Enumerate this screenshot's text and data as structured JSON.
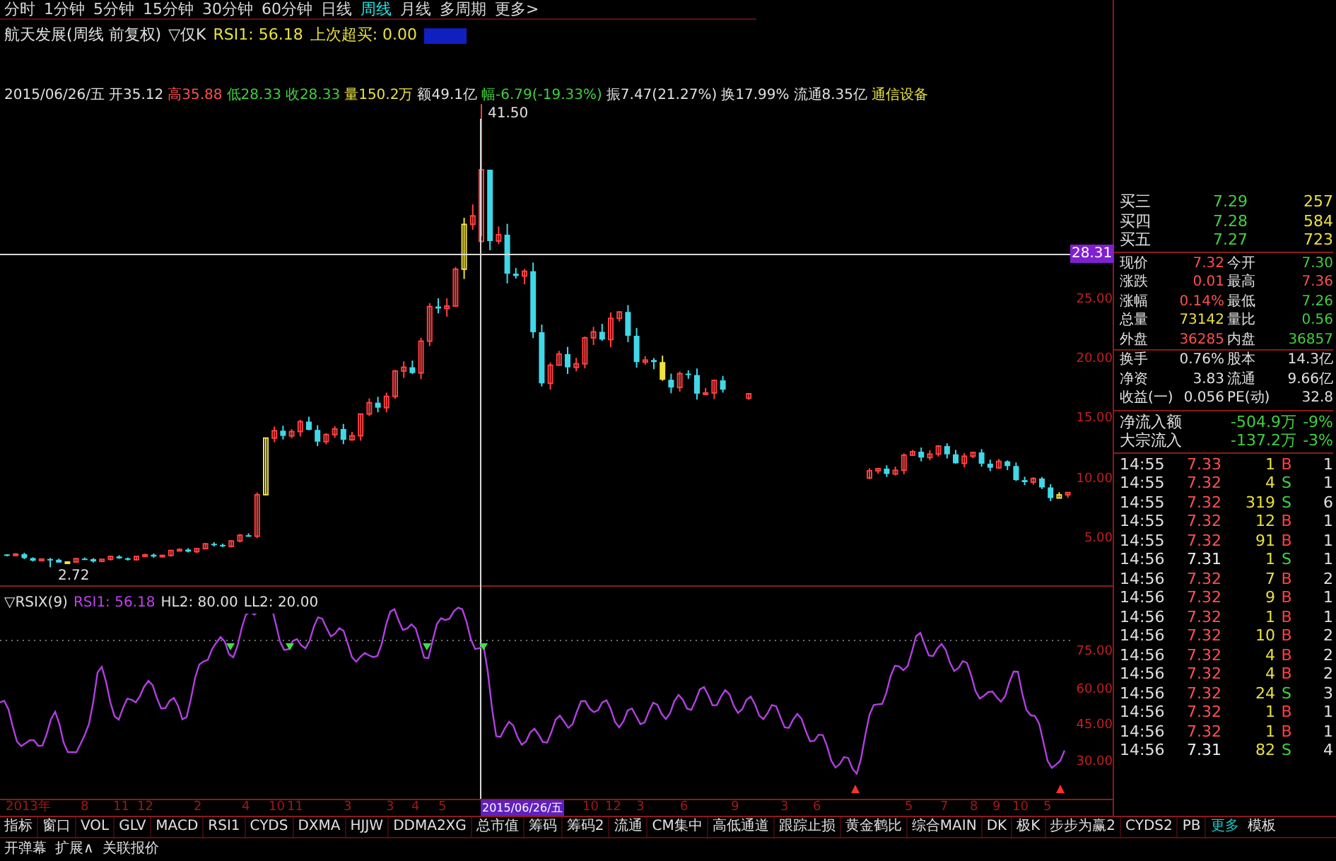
{
  "period_tabs": [
    {
      "label": "分时",
      "selected": false
    },
    {
      "label": "1分钟",
      "selected": false
    },
    {
      "label": "5分钟",
      "selected": false
    },
    {
      "label": "15分钟",
      "selected": false
    },
    {
      "label": "30分钟",
      "selected": false
    },
    {
      "label": "60分钟",
      "selected": false
    },
    {
      "label": "日线",
      "selected": false
    },
    {
      "label": "周线",
      "selected": true
    },
    {
      "label": "月线",
      "selected": false
    },
    {
      "label": "多周期",
      "selected": false
    },
    {
      "label": "更多>",
      "selected": false
    }
  ],
  "chart_title": {
    "name": "航天发展(周线 前复权)",
    "mode": "▽仅K",
    "indicator": "RSI1: 56.18",
    "last_overbought": "上次超买: 0.00"
  },
  "bar_info": [
    {
      "text": "2015/06/26/五",
      "color": "#e0e0e0"
    },
    {
      "text": "开35.12",
      "color": "#e0e0e0"
    },
    {
      "text": "高35.88",
      "color": "#ff5050"
    },
    {
      "text": "低28.33",
      "color": "#40d040"
    },
    {
      "text": "收28.33",
      "color": "#40d040"
    },
    {
      "text": "量150.2万",
      "color": "#e8e040"
    },
    {
      "text": "额49.1亿",
      "color": "#e0e0e0"
    },
    {
      "text": "幅-6.79(-19.33%)",
      "color": "#40d040"
    },
    {
      "text": "振7.47(21.27%)",
      "color": "#e0e0e0"
    },
    {
      "text": "换17.99%",
      "color": "#e0e0e0"
    },
    {
      "text": "流通8.35亿",
      "color": "#e0e0e0"
    },
    {
      "text": "通信设备",
      "color": "#e8e040"
    }
  ],
  "peak_label": "41.50",
  "low_label": "2.72",
  "price_axis": {
    "marker": "28.31",
    "ticks": [
      "25.00",
      "20.00",
      "15.00",
      "10.00",
      "5.00"
    ]
  },
  "rsi_title": {
    "name": "▽RSIX(9)",
    "rsi1": "RSI1: 56.18",
    "hl2": "HL2: 80.00",
    "ll2": "LL2: 20.00"
  },
  "rsi_axis": [
    "75.00",
    "60.00",
    "45.00",
    "30.00"
  ],
  "date_axis": {
    "labels": [
      "2013年",
      "8",
      "11",
      "12",
      "2",
      "4",
      "10",
      "11",
      "3",
      "3",
      "4",
      "5",
      "10",
      "12",
      "3",
      "6",
      "9",
      "3",
      "6",
      "5",
      "7",
      "8",
      "9",
      "10",
      "5"
    ],
    "cursor": "2015/06/26/五"
  },
  "indicator_tabs": [
    "指标",
    "窗口",
    "VOL",
    "GLV",
    "MACD",
    "RSI1",
    "CYDS",
    "DXMA",
    "HJJW",
    "DDMA2XG",
    "总市值",
    "筹码",
    "筹码2",
    "流通",
    "CM集中",
    "高低通道",
    "跟踪止损",
    "黄金鹤比",
    "综合MAIN",
    "DK",
    "极K",
    "步步为赢2",
    "CYDS2",
    "PB"
  ],
  "more_tab": "更多",
  "template_tab": "模板",
  "bottom_links": [
    "开弹幕",
    "扩展∧",
    "关联报价"
  ],
  "quote_panel": {
    "bids": [
      {
        "label": "买三",
        "price": "7.29",
        "volume": "257"
      },
      {
        "label": "买四",
        "price": "7.28",
        "volume": "584"
      },
      {
        "label": "买五",
        "price": "7.27",
        "volume": "723"
      }
    ],
    "stats": [
      {
        "label": "现价",
        "value": "7.32",
        "color": "#ff5050"
      },
      {
        "label": "今开",
        "value": "7.30",
        "color": "#40d040"
      },
      {
        "label": "涨跌",
        "value": "0.01",
        "color": "#ff5050"
      },
      {
        "label": "最高",
        "value": "7.36",
        "color": "#ff5050"
      },
      {
        "label": "涨幅",
        "value": "0.14%",
        "color": "#ff5050"
      },
      {
        "label": "最低",
        "value": "7.26",
        "color": "#40d040"
      },
      {
        "label": "总量",
        "value": "73142",
        "color": "#e8e040"
      },
      {
        "label": "量比",
        "value": "0.56",
        "color": "#40d040"
      },
      {
        "label": "外盘",
        "value": "36285",
        "color": "#ff5050"
      },
      {
        "label": "内盘",
        "value": "36857",
        "color": "#40d040"
      },
      {
        "label": "换手",
        "value": "0.76%",
        "color": "#e0e0e0"
      },
      {
        "label": "股本",
        "value": "14.3亿",
        "color": "#e0e0e0"
      },
      {
        "label": "净资",
        "value": "3.83",
        "color": "#e0e0e0"
      },
      {
        "label": "流通",
        "value": "9.66亿",
        "color": "#e0e0e0"
      },
      {
        "label": "收益(一)",
        "value": "0.056",
        "color": "#e0e0e0"
      },
      {
        "label": "PE(动)",
        "value": "32.8",
        "color": "#e0e0e0"
      }
    ],
    "flows": [
      {
        "label": "净流入额",
        "value": "-504.9万",
        "pct": "-9%"
      },
      {
        "label": "大宗流入",
        "value": "-137.2万",
        "pct": "-3%"
      }
    ],
    "ticks": [
      {
        "time": "14:55",
        "price": "7.33",
        "price_up": true,
        "volume": "1",
        "side": "B",
        "buy": true,
        "count": "1"
      },
      {
        "time": "14:55",
        "price": "7.32",
        "price_up": true,
        "volume": "4",
        "side": "S",
        "buy": false,
        "count": "1"
      },
      {
        "time": "14:55",
        "price": "7.32",
        "price_up": true,
        "volume": "319",
        "side": "S",
        "buy": false,
        "count": "6"
      },
      {
        "time": "14:55",
        "price": "7.32",
        "price_up": true,
        "volume": "12",
        "side": "B",
        "buy": true,
        "count": "1"
      },
      {
        "time": "14:55",
        "price": "7.32",
        "price_up": true,
        "volume": "91",
        "side": "B",
        "buy": true,
        "count": "1"
      },
      {
        "time": "14:56",
        "price": "7.31",
        "price_up": false,
        "volume": "1",
        "side": "S",
        "buy": false,
        "count": "1"
      },
      {
        "time": "14:56",
        "price": "7.32",
        "price_up": true,
        "volume": "7",
        "side": "B",
        "buy": true,
        "count": "2"
      },
      {
        "time": "14:56",
        "price": "7.32",
        "price_up": true,
        "volume": "9",
        "side": "B",
        "buy": true,
        "count": "1"
      },
      {
        "time": "14:56",
        "price": "7.32",
        "price_up": true,
        "volume": "1",
        "side": "B",
        "buy": true,
        "count": "1"
      },
      {
        "time": "14:56",
        "price": "7.32",
        "price_up": true,
        "volume": "10",
        "side": "B",
        "buy": true,
        "count": "2"
      },
      {
        "time": "14:56",
        "price": "7.32",
        "price_up": true,
        "volume": "4",
        "side": "B",
        "buy": true,
        "count": "2"
      },
      {
        "time": "14:56",
        "price": "7.32",
        "price_up": true,
        "volume": "4",
        "side": "B",
        "buy": true,
        "count": "2"
      },
      {
        "time": "14:56",
        "price": "7.32",
        "price_up": true,
        "volume": "24",
        "side": "S",
        "buy": false,
        "count": "3"
      },
      {
        "time": "14:56",
        "price": "7.32",
        "price_up": true,
        "volume": "1",
        "side": "B",
        "buy": true,
        "count": "1"
      },
      {
        "time": "14:56",
        "price": "7.32",
        "price_up": true,
        "volume": "1",
        "side": "B",
        "buy": true,
        "count": "1"
      },
      {
        "time": "14:56",
        "price": "7.31",
        "price_up": false,
        "volume": "82",
        "side": "S",
        "buy": false,
        "count": "4"
      }
    ]
  }
}
